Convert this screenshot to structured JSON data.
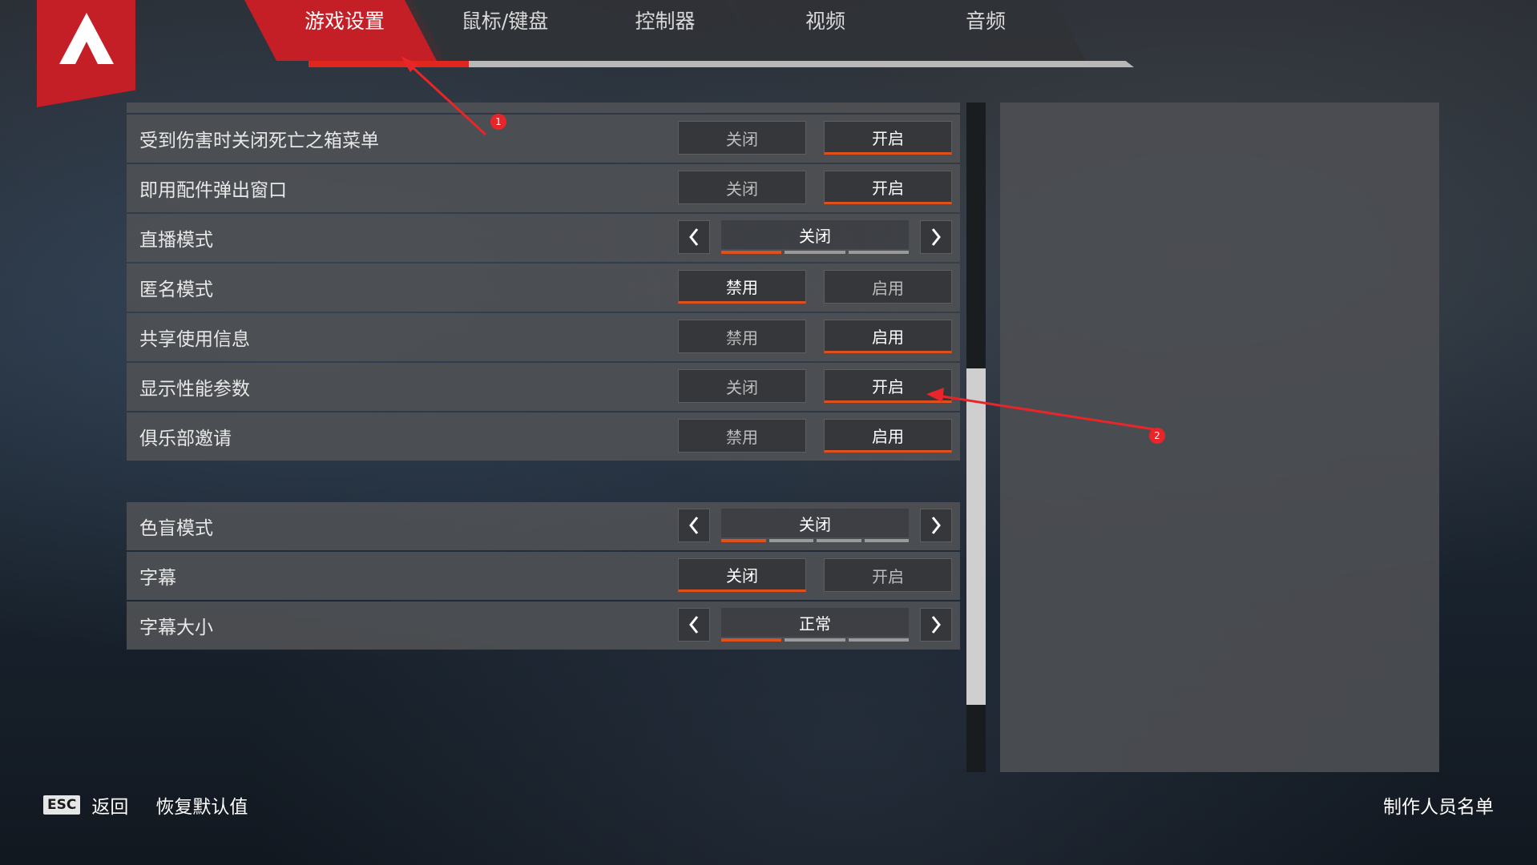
{
  "tabs": [
    {
      "label": "游戏设置",
      "active": true
    },
    {
      "label": "鼠标/键盘",
      "active": false
    },
    {
      "label": "控制器",
      "active": false
    },
    {
      "label": "视频",
      "active": false
    },
    {
      "label": "音频",
      "active": false
    }
  ],
  "group1": [
    {
      "label": "受到伤害时关闭死亡之箱菜单",
      "type": "toggle",
      "off": "关闭",
      "on": "开启",
      "selected": "on"
    },
    {
      "label": "即用配件弹出窗口",
      "type": "toggle",
      "off": "关闭",
      "on": "开启",
      "selected": "on"
    },
    {
      "label": "直播模式",
      "type": "select",
      "value": "关闭",
      "segments": 3,
      "index": 0
    },
    {
      "label": "匿名模式",
      "type": "toggle",
      "off": "禁用",
      "on": "启用",
      "selected": "off"
    },
    {
      "label": "共享使用信息",
      "type": "toggle",
      "off": "禁用",
      "on": "启用",
      "selected": "on"
    },
    {
      "label": "显示性能参数",
      "type": "toggle",
      "off": "关闭",
      "on": "开启",
      "selected": "on"
    },
    {
      "label": "俱乐部邀请",
      "type": "toggle",
      "off": "禁用",
      "on": "启用",
      "selected": "on"
    }
  ],
  "group2": [
    {
      "label": "色盲模式",
      "type": "select",
      "value": "关闭",
      "segments": 4,
      "index": 0
    },
    {
      "label": "字幕",
      "type": "toggle",
      "off": "关闭",
      "on": "开启",
      "selected": "off"
    },
    {
      "label": "字幕大小",
      "type": "select",
      "value": "正常",
      "segments": 3,
      "index": 0
    }
  ],
  "footer": {
    "esc_key": "ESC",
    "back": "返回",
    "restore_defaults": "恢复默认值",
    "credits": "制作人员名单"
  },
  "annotations": {
    "badge1": "1",
    "badge2": "2"
  },
  "colors": {
    "accent": "#c41e26",
    "selected_underline": "#e0501d"
  },
  "icons": {
    "logo": "apex-logo-icon",
    "prev": "chevron-left-icon",
    "next": "chevron-right-icon"
  }
}
